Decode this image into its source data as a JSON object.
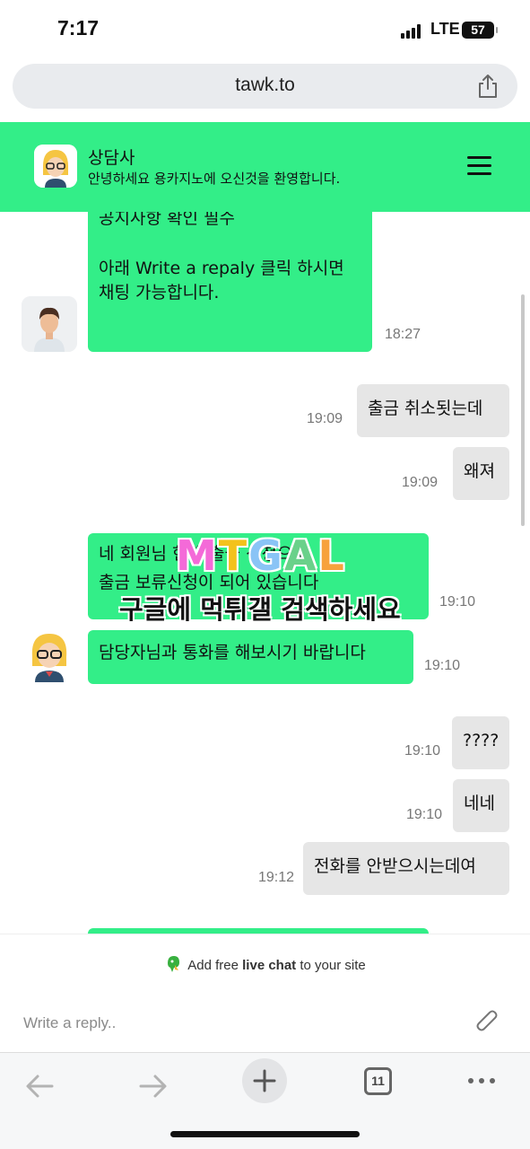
{
  "status_bar": {
    "time": "7:17",
    "network": "LTE",
    "battery": "57"
  },
  "browser": {
    "url": "tawk.to",
    "tab_count": "11"
  },
  "chat_header": {
    "agent_name": "상담사",
    "welcome": "안녕하세요 용카지노에 오신것을 환영합니다."
  },
  "messages": [
    {
      "from": "agent",
      "lines": [
        "공지사항 확인 필수",
        "",
        "아래 Write a repaly 클릭 하시면",
        "채팅 가능합니다."
      ],
      "time": "18:27"
    },
    {
      "from": "user",
      "text": "출금 취소됫는데",
      "time": "19:09"
    },
    {
      "from": "user",
      "text": "왜져",
      "time": "19:09"
    },
    {
      "from": "agent",
      "lines": [
        "네 회원님 현재 출금 신청으로",
        "출금 보류신청이 되어 있습니다"
      ],
      "time": "19:10"
    },
    {
      "from": "agent",
      "text": "담당자님과 통화를 해보시기 바랍니다",
      "time": "19:10"
    },
    {
      "from": "user",
      "text": "????",
      "time": "19:10"
    },
    {
      "from": "user",
      "text": "네네",
      "time": "19:10"
    },
    {
      "from": "user",
      "text": "전화를 안받으시는데여",
      "time": "19:12"
    }
  ],
  "watermark": {
    "logo": [
      "M",
      "T",
      "G",
      "A",
      "L"
    ],
    "text": "구글에 먹튀갤 검색하세요"
  },
  "footer": {
    "powered_pre": "Add free ",
    "powered_bold": "live chat",
    "powered_post": " to your site",
    "reply_placeholder": "Write a reply.."
  }
}
